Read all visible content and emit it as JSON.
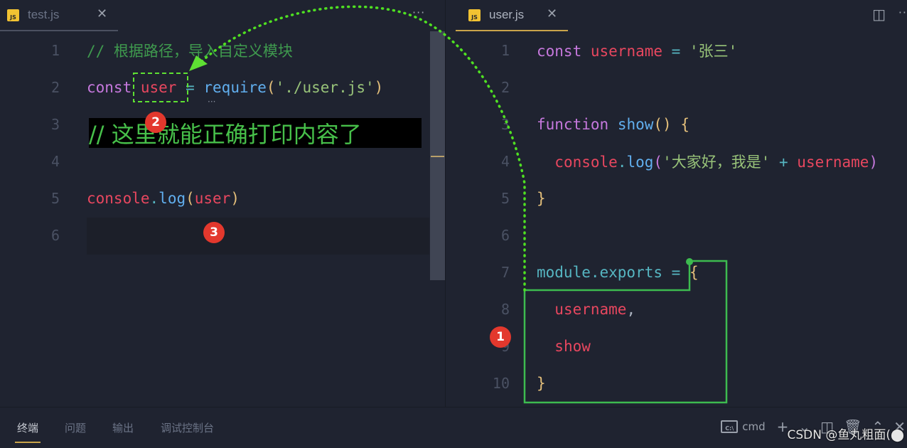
{
  "left_editor": {
    "tab": {
      "filename": "test.js",
      "icon": "js-file-icon",
      "close": "✕"
    },
    "more": "···",
    "lines": [
      {
        "n": "1",
        "tokens": [
          {
            "t": "// 根据路径，导入自定义模块",
            "c": "comment"
          }
        ]
      },
      {
        "n": "2",
        "tokens": [
          {
            "t": "const",
            "c": "kw"
          },
          {
            "t": " ",
            "c": "plain"
          },
          {
            "t": "user",
            "c": "var"
          },
          {
            "t": " = ",
            "c": "op"
          },
          {
            "t": "require",
            "c": "fn"
          },
          {
            "t": "(",
            "c": "paren"
          },
          {
            "t": "'./user.js'",
            "c": "str"
          },
          {
            "t": ")",
            "c": "paren"
          }
        ]
      },
      {
        "n": "3",
        "tokens": []
      },
      {
        "n": "4",
        "tokens": []
      },
      {
        "n": "5",
        "tokens": [
          {
            "t": "console",
            "c": "var"
          },
          {
            "t": ".",
            "c": "op"
          },
          {
            "t": "log",
            "c": "fn"
          },
          {
            "t": "(",
            "c": "paren"
          },
          {
            "t": "user",
            "c": "var"
          },
          {
            "t": ")",
            "c": "paren"
          }
        ]
      },
      {
        "n": "6",
        "tokens": []
      }
    ],
    "hint_dots": "···",
    "annotation": "// 这里就能正确打印内容了"
  },
  "right_editor": {
    "tab": {
      "filename": "user.js",
      "icon": "js-file-icon",
      "close": "✕"
    },
    "split_icon": "◫",
    "more": "··",
    "lines": [
      {
        "n": "1",
        "tokens": [
          {
            "t": "const",
            "c": "kw"
          },
          {
            "t": " ",
            "c": "plain"
          },
          {
            "t": "username",
            "c": "var"
          },
          {
            "t": " = ",
            "c": "op"
          },
          {
            "t": "'张三'",
            "c": "str"
          }
        ]
      },
      {
        "n": "2",
        "tokens": []
      },
      {
        "n": "3",
        "tokens": [
          {
            "t": "function",
            "c": "kw"
          },
          {
            "t": " ",
            "c": "plain"
          },
          {
            "t": "show",
            "c": "fn"
          },
          {
            "t": "()",
            "c": "paren"
          },
          {
            "t": " ",
            "c": "plain"
          },
          {
            "t": "{",
            "c": "brace"
          }
        ]
      },
      {
        "n": "4",
        "tokens": [
          {
            "t": "  ",
            "c": "plain"
          },
          {
            "t": "console",
            "c": "var"
          },
          {
            "t": ".",
            "c": "op"
          },
          {
            "t": "log",
            "c": "fn"
          },
          {
            "t": "(",
            "c": "paren2"
          },
          {
            "t": "'大家好，我是'",
            "c": "str"
          },
          {
            "t": " + ",
            "c": "op"
          },
          {
            "t": "username",
            "c": "var"
          },
          {
            "t": ")",
            "c": "paren2"
          }
        ]
      },
      {
        "n": "5",
        "tokens": [
          {
            "t": "}",
            "c": "brace"
          }
        ]
      },
      {
        "n": "6",
        "tokens": []
      },
      {
        "n": "7",
        "tokens": [
          {
            "t": "module.exports",
            "c": "prop"
          },
          {
            "t": " = ",
            "c": "op"
          },
          {
            "t": "{",
            "c": "brace"
          }
        ]
      },
      {
        "n": "8",
        "tokens": [
          {
            "t": "  ",
            "c": "plain"
          },
          {
            "t": "username",
            "c": "var"
          },
          {
            "t": ",",
            "c": "plain"
          }
        ]
      },
      {
        "n": "9",
        "tokens": [
          {
            "t": "  ",
            "c": "plain"
          },
          {
            "t": "show",
            "c": "var"
          }
        ]
      },
      {
        "n": "10",
        "tokens": [
          {
            "t": "}",
            "c": "brace"
          }
        ]
      }
    ]
  },
  "badges": {
    "one": "1",
    "two": "2",
    "three": "3"
  },
  "panel": {
    "tabs": [
      {
        "label": "终端",
        "active": true
      },
      {
        "label": "问题",
        "active": false
      },
      {
        "label": "输出",
        "active": false
      },
      {
        "label": "调试控制台",
        "active": false
      }
    ],
    "terminal_icon_text": "C:\\",
    "terminal_name": "cmd",
    "tools": [
      "+",
      "⌄",
      "◫",
      "🗑",
      "⌃",
      "✕"
    ]
  },
  "watermark": "CSDN @鱼丸粗面(⬤",
  "colors": {
    "background": "#1f2330",
    "accent_tab_underline": "#c9a44a",
    "annotation_green": "#47c04a",
    "arrow_green": "#5ee033",
    "badge_red": "#e3382d"
  }
}
